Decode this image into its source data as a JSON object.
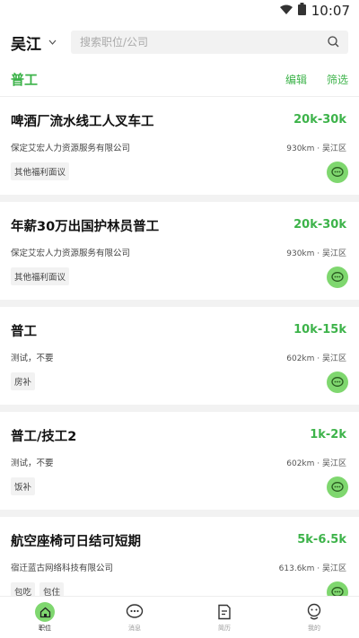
{
  "status_bar": {
    "time": "10:07",
    "icons": [
      "wifi-icon",
      "battery-icon"
    ]
  },
  "header": {
    "city": "吴江",
    "search_placeholder": "搜索职位/公司"
  },
  "filter_bar": {
    "category": "普工",
    "edit_label": "编辑",
    "filter_label": "筛选"
  },
  "jobs": [
    {
      "title": "啤酒厂流水线工人叉车工",
      "salary": "20k-30k",
      "company": "保定艾宏人力资源服务有限公司",
      "location": "930km · 吴江区",
      "tags": [
        "其他福利面议"
      ]
    },
    {
      "title": "年薪30万出国护林员普工",
      "salary": "20k-30k",
      "company": "保定艾宏人力资源服务有限公司",
      "location": "930km · 吴江区",
      "tags": [
        "其他福利面议"
      ]
    },
    {
      "title": "普工",
      "salary": "10k-15k",
      "company": "测试，不要",
      "location": "602km · 吴江区",
      "tags": [
        "房补"
      ]
    },
    {
      "title": "普工/技工2",
      "salary": "1k-2k",
      "company": "测试，不要",
      "location": "602km · 吴江区",
      "tags": [
        "饭补"
      ]
    },
    {
      "title": "航空座椅可日结可短期",
      "salary": "5k-6.5k",
      "company": "宿迁蓝古网络科技有限公司",
      "location": "613.6km · 吴江区",
      "tags": [
        "包吃",
        "包住"
      ]
    }
  ],
  "tab_bar": [
    {
      "label": "职位",
      "icon": "home-icon",
      "active": true
    },
    {
      "label": "消息",
      "icon": "message-icon",
      "active": false
    },
    {
      "label": "简历",
      "icon": "resume-icon",
      "active": false
    },
    {
      "label": "我的",
      "icon": "profile-icon",
      "active": false
    }
  ],
  "colors": {
    "accent": "#3db34a",
    "chat_button": "#7fd76f"
  }
}
